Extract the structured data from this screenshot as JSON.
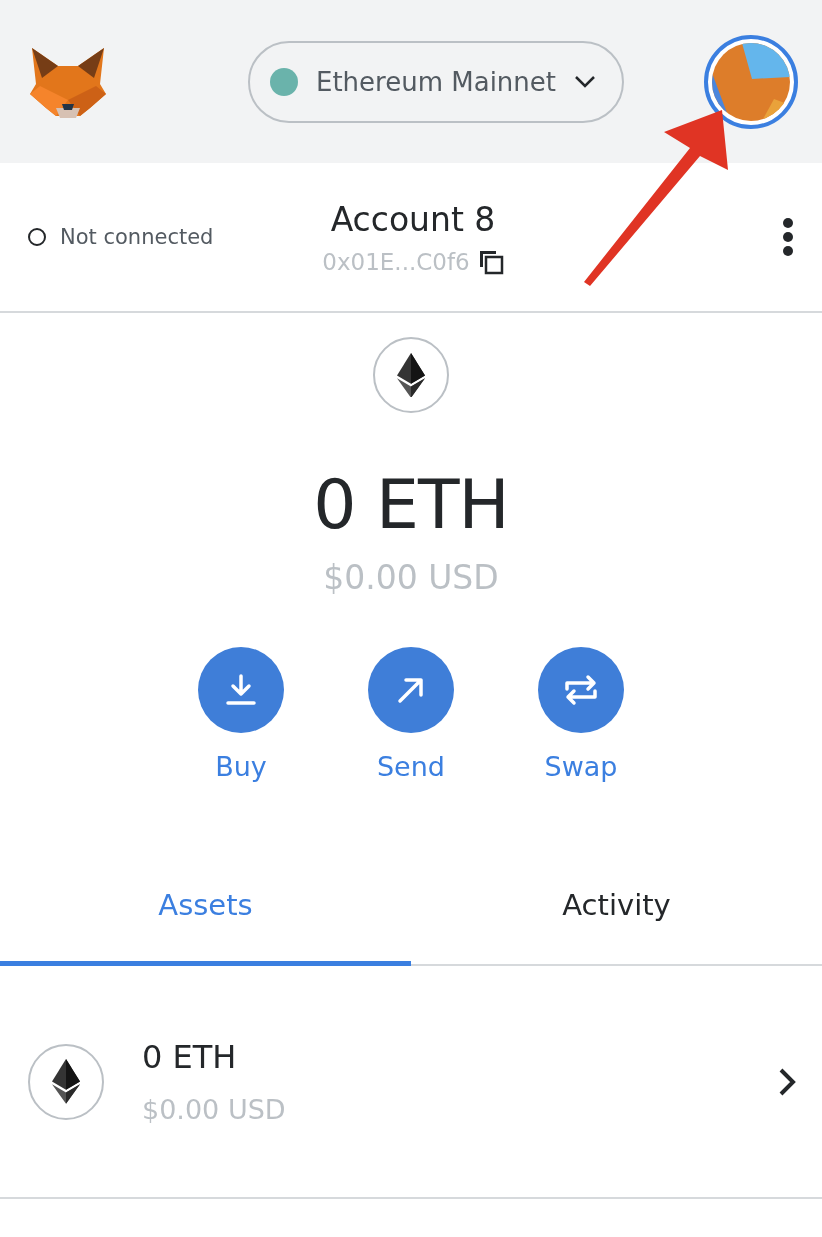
{
  "header": {
    "network": {
      "label": "Ethereum Mainnet",
      "color": "#6ab3ab"
    }
  },
  "account": {
    "connection": "Not connected",
    "name": "Account 8",
    "address": "0x01E...C0f6"
  },
  "balance": {
    "amount": "0 ETH",
    "fiat": "$0.00 USD"
  },
  "actions": [
    {
      "kind": "buy",
      "label": "Buy"
    },
    {
      "kind": "send",
      "label": "Send"
    },
    {
      "kind": "swap",
      "label": "Swap"
    }
  ],
  "tabs": [
    {
      "label": "Assets",
      "selected": true
    },
    {
      "label": "Activity",
      "selected": false
    }
  ],
  "assets": [
    {
      "amount": "0 ETH",
      "fiat": "$0.00 USD"
    }
  ]
}
